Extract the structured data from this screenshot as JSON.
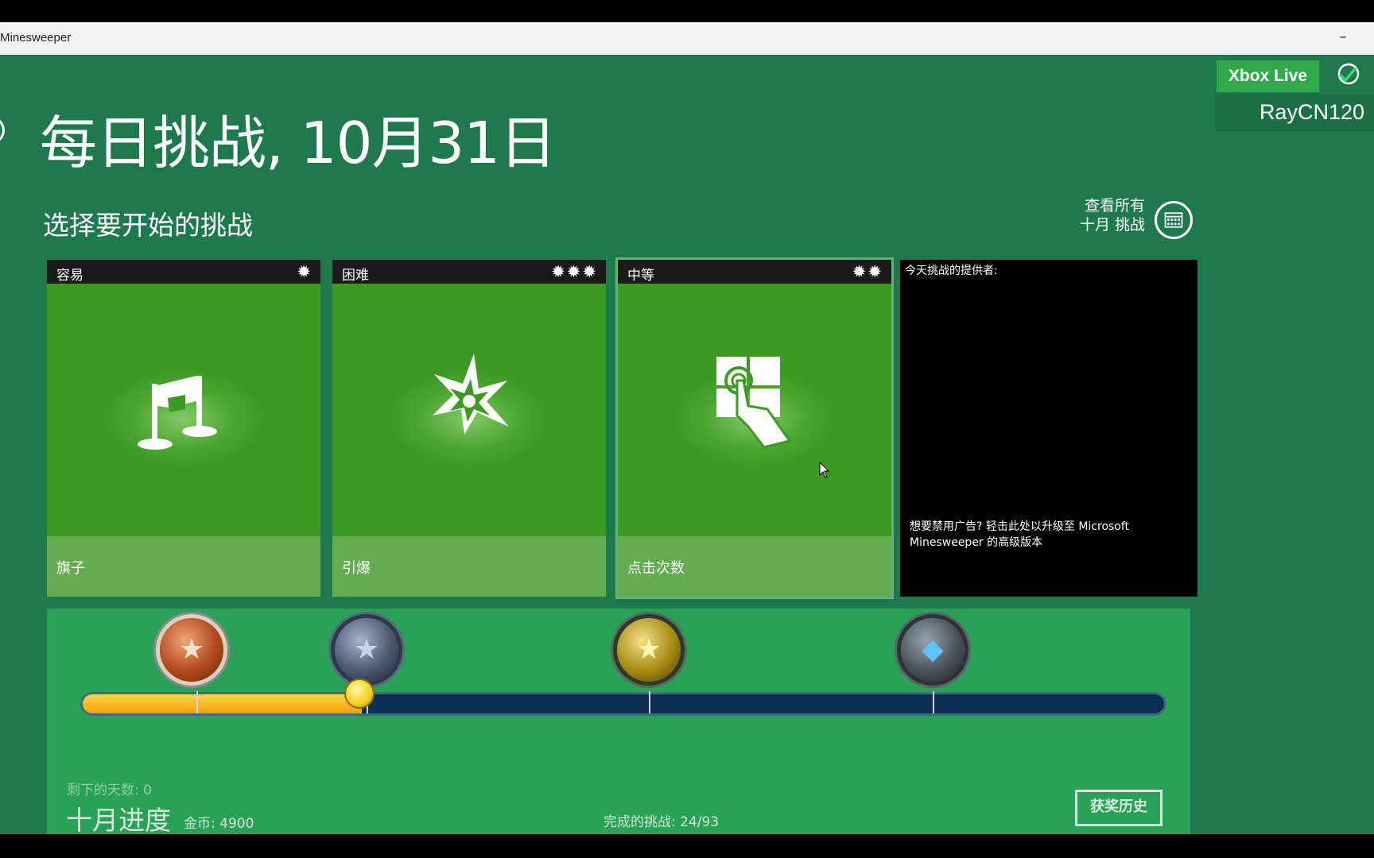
{
  "window": {
    "title": "Minesweeper",
    "minimize_label": "–"
  },
  "header": {
    "title": "每日挑战, 10月31日",
    "subtitle": "选择要开始的挑战",
    "xbox_live_label": "Xbox Live",
    "username": "RayCN120",
    "view_all_line1": "查看所有",
    "view_all_line2": "十月 挑战"
  },
  "challenges": [
    {
      "difficulty": "容易",
      "stars": "✹",
      "star_count": 1,
      "label": "旗子",
      "icon": "flags-icon"
    },
    {
      "difficulty": "困难",
      "stars": "✹✹✹",
      "star_count": 3,
      "label": "引爆",
      "icon": "explosion-icon"
    },
    {
      "difficulty": "中等",
      "stars": "✹✹",
      "star_count": 2,
      "label": "点击次数",
      "icon": "tap-icon"
    }
  ],
  "ad": {
    "provider_label": "今天挑战的提供者:",
    "upgrade_text": "想要禁用广告? 轻击此处以升级至 Microsoft Minesweeper 的高级版本"
  },
  "progress": {
    "days_left": "剩下的天数:  0",
    "month_title": "十月进度",
    "coins": "金币: 4900",
    "completed": "完成的挑战: 24/93",
    "awards_label": "获奖历史",
    "medals": [
      "bronze-medal-icon",
      "silver-medal-icon",
      "gold-medal-icon",
      "diamond-medal-icon"
    ],
    "fill_fraction": 0.258
  },
  "colors": {
    "background": "#1e7a4c",
    "card_green": "#3c9a22",
    "card_footer": "#63ac51",
    "xbox_green": "#2fa94a",
    "progress_fill": "#f5a000",
    "track": "#0c2e55"
  }
}
